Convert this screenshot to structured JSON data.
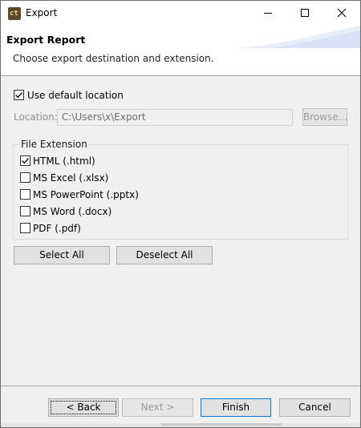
{
  "window": {
    "title": "Export",
    "icon_text": "ct",
    "icon": "ct-app-icon",
    "controls": [
      "minimize-icon",
      "maximize-icon",
      "close-icon"
    ]
  },
  "banner": {
    "title": "Export Report",
    "description": "Choose export destination and extension."
  },
  "location": {
    "use_default_label": "Use default location",
    "use_default_checked": true,
    "label": "Location:",
    "value": "C:\\Users\\x\\Export",
    "browse_label": "Browse...",
    "enabled": false
  },
  "file_extension": {
    "group_title": "File Extension",
    "options": [
      {
        "label": "HTML (.html)",
        "checked": true
      },
      {
        "label": "MS Excel (.xlsx)",
        "checked": false
      },
      {
        "label": "MS PowerPoint (.pptx)",
        "checked": false
      },
      {
        "label": "MS Word (.docx)",
        "checked": false
      },
      {
        "label": "PDF (.pdf)",
        "checked": false
      }
    ],
    "select_all_label": "Select All",
    "deselect_all_label": "Deselect All"
  },
  "footer": {
    "back_label": "< Back",
    "next_label": "Next >",
    "finish_label": "Finish",
    "cancel_label": "Cancel"
  },
  "colors": {
    "focus_border": "#0078d7",
    "disabled_text": "#9a9a9a",
    "banner_bg": "#ffffff"
  }
}
